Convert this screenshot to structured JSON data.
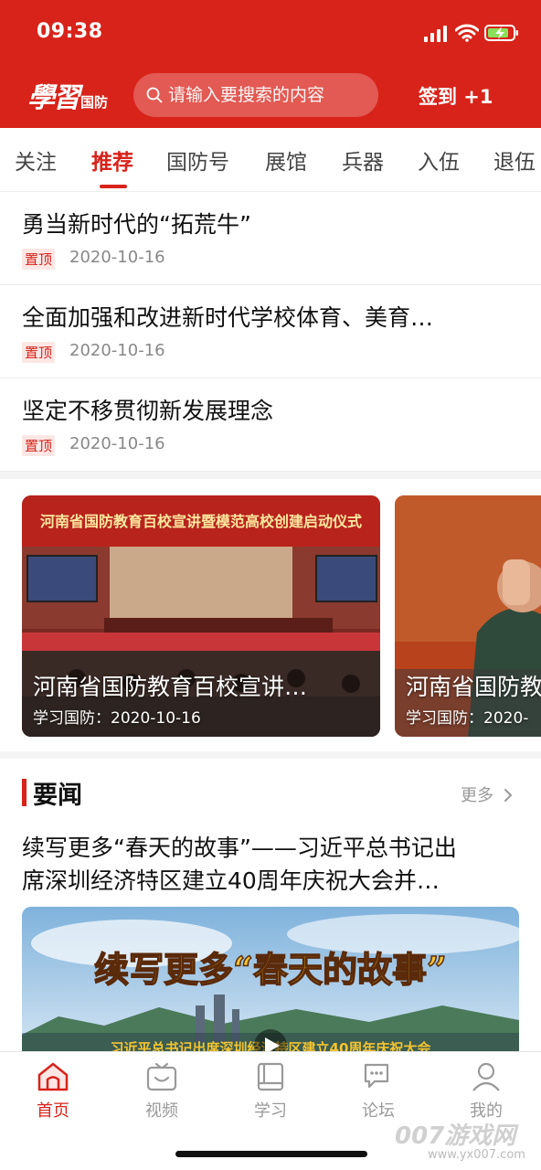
{
  "status_bar": {
    "time": "09:38"
  },
  "header": {
    "logo_main": "學習",
    "logo_sub": "国防",
    "search_placeholder": "请输入要搜索的内容",
    "signin_label": "签到 +1"
  },
  "tabs": [
    {
      "label": "关注",
      "active": false
    },
    {
      "label": "推荐",
      "active": true
    },
    {
      "label": "国防号",
      "active": false
    },
    {
      "label": "展馆",
      "active": false
    },
    {
      "label": "兵器",
      "active": false
    },
    {
      "label": "入伍",
      "active": false
    },
    {
      "label": "退伍",
      "active": false
    }
  ],
  "pinned": [
    {
      "title": "勇当新时代的“拓荒牛”",
      "tag": "置顶",
      "date": "2020-10-16"
    },
    {
      "title": "全面加强和改进新时代学校体育、美育…",
      "tag": "置顶",
      "date": "2020-10-16"
    },
    {
      "title": "坚定不移贯彻新发展理念",
      "tag": "置顶",
      "date": "2020-10-16"
    }
  ],
  "carousel": [
    {
      "title": "河南省国防教育百校宣讲…",
      "meta": "学习国防：2020-10-16",
      "banner_text": "河南省国防教育百校宣讲暨模范高校创建启动仪式"
    },
    {
      "title": "河南省国防教",
      "meta": "学习国防：2020-"
    }
  ],
  "news": {
    "section_title": "要闻",
    "more_label": "更多",
    "headline_line1": "续写更多“春天的故事”——习近平总书记出",
    "headline_line2": "席深圳经济特区建立40周年庆祝大会并…",
    "banner_title": "续写更多“春天的故事”",
    "banner_sub": "习近平总书记出席深圳经济特区建立40周年庆祝大会"
  },
  "bottom_nav": [
    {
      "label": "首页",
      "icon": "home-icon",
      "active": true
    },
    {
      "label": "视频",
      "icon": "video-icon",
      "active": false
    },
    {
      "label": "学习",
      "icon": "book-icon",
      "active": false
    },
    {
      "label": "论坛",
      "icon": "forum-icon",
      "active": false
    },
    {
      "label": "我的",
      "icon": "user-icon",
      "active": false
    }
  ],
  "watermark": {
    "text": "007游戏网",
    "url": "www.yx007.com"
  },
  "colors": {
    "brand_red": "#d8231a",
    "inactive_gray": "#999999"
  }
}
